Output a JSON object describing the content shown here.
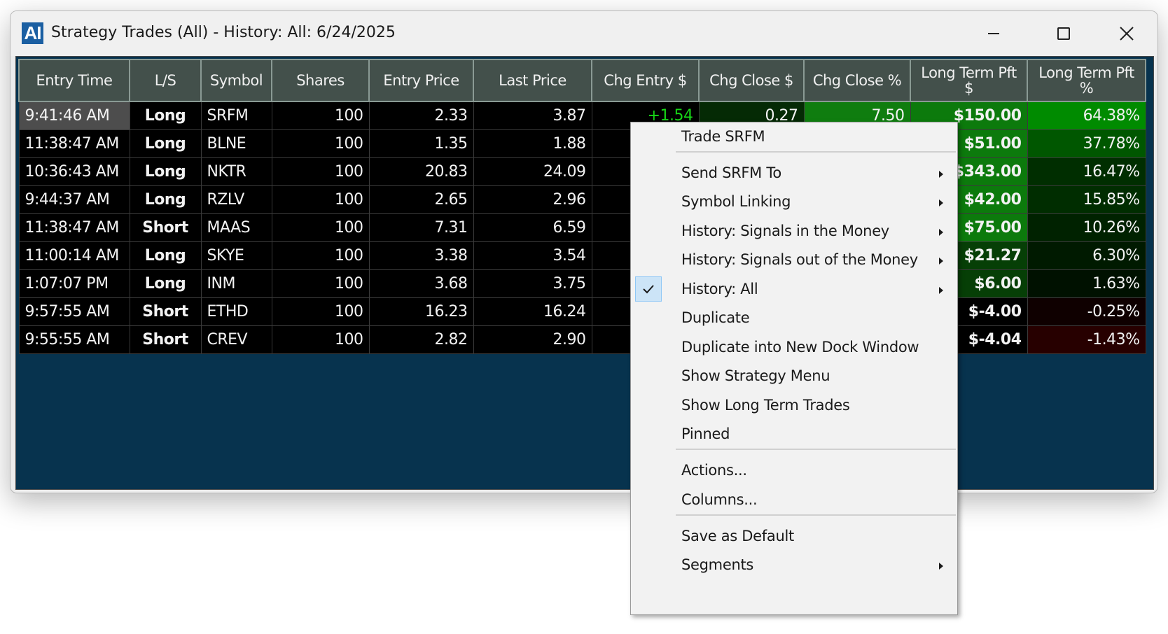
{
  "window": {
    "title": "Strategy Trades (All) - History: All: 6/24/2025",
    "app_icon_text": "AI",
    "icon_names": {
      "minimize": "minimize-icon",
      "maximize": "maximize-icon",
      "close": "close-icon"
    }
  },
  "table": {
    "headers": [
      {
        "l1": "Entry Time",
        "l2": ""
      },
      {
        "l1": "L/S",
        "l2": ""
      },
      {
        "l1": "Symbol",
        "l2": ""
      },
      {
        "l1": "Shares",
        "l2": ""
      },
      {
        "l1": "Entry Price",
        "l2": ""
      },
      {
        "l1": "Last Price",
        "l2": ""
      },
      {
        "l1": "Chg Entry $",
        "l2": ""
      },
      {
        "l1": "Chg Close $",
        "l2": ""
      },
      {
        "l1": "Chg Close %",
        "l2": ""
      },
      {
        "l1": "Long Term Pft",
        "l2": "$"
      },
      {
        "l1": "Long Term Pft",
        "l2": "%"
      }
    ],
    "rows": [
      {
        "time": "9:41:46 AM",
        "ls": "Long",
        "symbol": "SRFM",
        "shares": "100",
        "entry": "2.33",
        "last": "3.87",
        "chg_entry": "+1.54",
        "chg_close": "0.27",
        "chg_close_pct": "7.50",
        "ltp": "$150.00",
        "ltp_pct": "64.38%"
      },
      {
        "time": "11:38:47 AM",
        "ls": "Long",
        "symbol": "BLNE",
        "shares": "100",
        "entry": "1.35",
        "last": "1.88",
        "chg_entry": "",
        "chg_close": "",
        "chg_close_pct": "",
        "ltp": "$51.00",
        "ltp_pct": "37.78%"
      },
      {
        "time": "10:36:43 AM",
        "ls": "Long",
        "symbol": "NKTR",
        "shares": "100",
        "entry": "20.83",
        "last": "24.09",
        "chg_entry": "",
        "chg_close": "",
        "chg_close_pct": "",
        "ltp": "$343.00",
        "ltp_pct": "16.47%"
      },
      {
        "time": "9:44:37 AM",
        "ls": "Long",
        "symbol": "RZLV",
        "shares": "100",
        "entry": "2.65",
        "last": "2.96",
        "chg_entry": "",
        "chg_close": "",
        "chg_close_pct": "",
        "ltp": "$42.00",
        "ltp_pct": "15.85%"
      },
      {
        "time": "11:38:47 AM",
        "ls": "Short",
        "symbol": "MAAS",
        "shares": "100",
        "entry": "7.31",
        "last": "6.59",
        "chg_entry": "",
        "chg_close": "",
        "chg_close_pct": "",
        "ltp": "$75.00",
        "ltp_pct": "10.26%"
      },
      {
        "time": "11:00:14 AM",
        "ls": "Long",
        "symbol": "SKYE",
        "shares": "100",
        "entry": "3.38",
        "last": "3.54",
        "chg_entry": "",
        "chg_close": "",
        "chg_close_pct": "",
        "ltp": "$21.27",
        "ltp_pct": "6.30%"
      },
      {
        "time": "1:07:07 PM",
        "ls": "Long",
        "symbol": "INM",
        "shares": "100",
        "entry": "3.68",
        "last": "3.75",
        "chg_entry": "",
        "chg_close": "",
        "chg_close_pct": "",
        "ltp": "$6.00",
        "ltp_pct": "1.63%"
      },
      {
        "time": "9:57:55 AM",
        "ls": "Short",
        "symbol": "ETHD",
        "shares": "100",
        "entry": "16.23",
        "last": "16.24",
        "chg_entry": "",
        "chg_close": "",
        "chg_close_pct": "",
        "ltp": "$-4.00",
        "ltp_pct": "-0.25%"
      },
      {
        "time": "9:55:55 AM",
        "ls": "Short",
        "symbol": "CREV",
        "shares": "100",
        "entry": "2.82",
        "last": "2.90",
        "chg_entry": "",
        "chg_close": "",
        "chg_close_pct": "",
        "ltp": "$-4.04",
        "ltp_pct": "-1.43%"
      }
    ]
  },
  "context_menu": {
    "items": [
      {
        "label": "Trade SRFM",
        "submenu": false,
        "checked": false,
        "sep_after": true
      },
      {
        "label": "Send SRFM To",
        "submenu": true,
        "checked": false,
        "sep_after": false
      },
      {
        "label": "Symbol Linking",
        "submenu": true,
        "checked": false,
        "sep_after": false
      },
      {
        "label": "History: Signals in the Money",
        "submenu": true,
        "checked": false,
        "sep_after": false
      },
      {
        "label": "History: Signals out of the Money",
        "submenu": true,
        "checked": false,
        "sep_after": false
      },
      {
        "label": "History: All",
        "submenu": true,
        "checked": true,
        "sep_after": false
      },
      {
        "label": "Duplicate",
        "submenu": false,
        "checked": false,
        "sep_after": false
      },
      {
        "label": "Duplicate into New Dock Window",
        "submenu": false,
        "checked": false,
        "sep_after": false
      },
      {
        "label": "Show Strategy Menu",
        "submenu": false,
        "checked": false,
        "sep_after": false
      },
      {
        "label": "Show Long Term Trades",
        "submenu": false,
        "checked": false,
        "sep_after": false
      },
      {
        "label": "Pinned",
        "submenu": false,
        "checked": false,
        "sep_after": true
      },
      {
        "label": "Actions...",
        "submenu": false,
        "checked": false,
        "sep_after": false
      },
      {
        "label": "Columns...",
        "submenu": false,
        "checked": false,
        "sep_after": true
      },
      {
        "label": "Save as Default",
        "submenu": false,
        "checked": false,
        "sep_after": false
      },
      {
        "label": "Segments",
        "submenu": true,
        "checked": false,
        "sep_after": false
      }
    ]
  },
  "colors": {
    "grid_background": "#07334e",
    "header_background": "#43504b",
    "long": "#17d617",
    "short": "#ff1d1d",
    "profit_green": "#0a8a0a",
    "loss_red": "#3a0606"
  }
}
